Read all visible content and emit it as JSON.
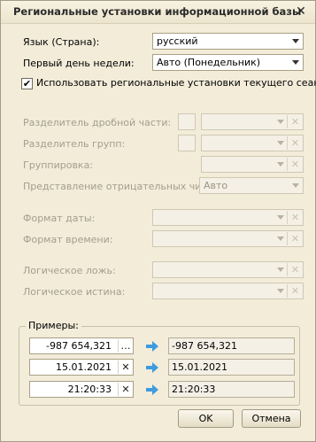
{
  "window": {
    "title": "Региональные установки информационной базы",
    "close_glyph": "✕"
  },
  "language": {
    "label": "Язык (Страна):",
    "value": "русский"
  },
  "first_day": {
    "label": "Первый день недели:",
    "value": "Авто (Понедельник)"
  },
  "use_session": {
    "label": "Использовать региональные установки текущего сеанса",
    "checked": true,
    "mark": "✔"
  },
  "number_settings": {
    "decimal_separator_label": "Разделитель дробной части:",
    "group_separator_label": "Разделитель групп:",
    "grouping_label": "Группировка:",
    "negative_label": "Представление отрицательных чисел:",
    "negative_value": "Авто"
  },
  "date_formats": {
    "date_label": "Формат даты:",
    "time_label": "Формат времени:"
  },
  "booleans": {
    "false_label": "Логическое ложь:",
    "true_label": "Логическое истина:"
  },
  "examples": {
    "title": "Примеры:",
    "rows": [
      {
        "input": "-987 654,321",
        "button": "…",
        "button_icon": "ellipsis-icon",
        "result": "-987 654,321"
      },
      {
        "input": "15.01.2021",
        "button": "✕",
        "button_icon": "clear-icon",
        "result": "15.01.2021"
      },
      {
        "input": "21:20:33",
        "button": "✕",
        "button_icon": "clear-icon",
        "result": "21:20:33"
      }
    ]
  },
  "buttons": {
    "ok": "OK",
    "cancel": "Отмена"
  },
  "colors": {
    "accent_arrow": "#3d9be0",
    "dialog_bg": "#f2ecd9"
  }
}
